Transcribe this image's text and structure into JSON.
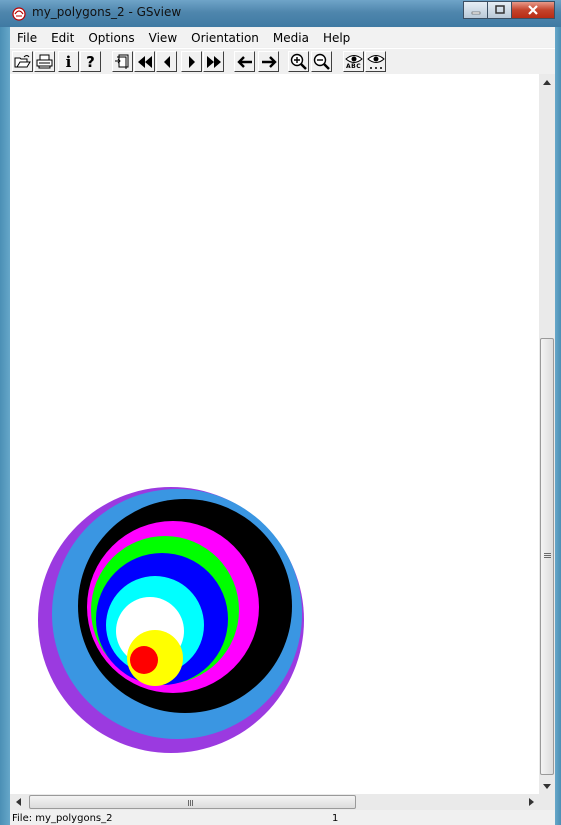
{
  "window": {
    "title": "my_polygons_2 - GSview",
    "controls": [
      "minimize",
      "maximize",
      "close"
    ]
  },
  "menu": [
    "File",
    "Edit",
    "Options",
    "View",
    "Orientation",
    "Media",
    "Help"
  ],
  "toolbar": {
    "buttons": [
      {
        "icon": "open-file-icon"
      },
      {
        "icon": "print-icon"
      },
      {
        "icon": "info-icon",
        "label": "i"
      },
      {
        "icon": "help-icon",
        "label": "?"
      },
      {
        "icon": "goto-page-icon"
      },
      {
        "icon": "first-page-icon"
      },
      {
        "icon": "previous-page-icon"
      },
      {
        "icon": "next-page-icon"
      },
      {
        "icon": "last-page-icon"
      },
      {
        "icon": "back-arrow-icon"
      },
      {
        "icon": "forward-arrow-icon"
      },
      {
        "icon": "zoom-in-icon"
      },
      {
        "icon": "zoom-out-icon"
      },
      {
        "icon": "view-text-icon",
        "label": "ABC"
      },
      {
        "icon": "view-dots-icon"
      }
    ]
  },
  "document": {
    "circles": [
      {
        "color": "#9b3ae0"
      },
      {
        "color": "#3a96e2"
      },
      {
        "color": "#000000"
      },
      {
        "color": "#ff00ff"
      },
      {
        "color": "#00ff00"
      },
      {
        "color": "#0000ff"
      },
      {
        "color": "#00ffff"
      },
      {
        "color": "#ffffff"
      },
      {
        "color": "#ffff00"
      },
      {
        "color": "#ff0000"
      }
    ]
  },
  "statusbar": {
    "file": "File: my_polygons_2",
    "page": "1"
  }
}
